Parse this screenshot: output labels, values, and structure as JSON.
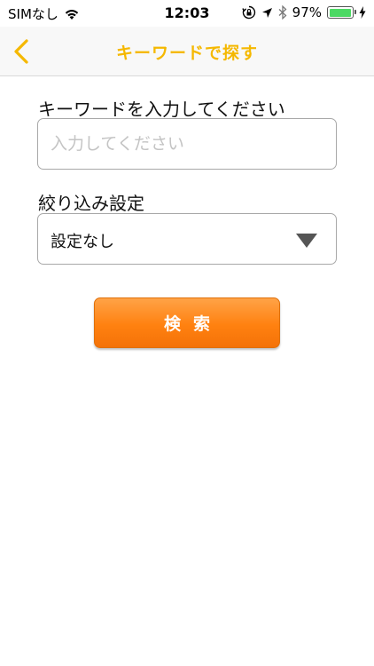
{
  "status_bar": {
    "carrier": "SIMなし",
    "time": "12:03",
    "battery_percent": "97%",
    "battery_level": 0.97,
    "battery_color": "#4cd964"
  },
  "nav": {
    "title": "キーワードで探す",
    "back_icon": "chevron-left-icon",
    "accent_color": "#f5b800"
  },
  "form": {
    "keyword_label": "キーワードを入力してください",
    "keyword_placeholder": "入力してください",
    "keyword_value": "",
    "filter_label": "絞り込み設定",
    "filter_selected": "設定なし",
    "search_button_label": "検索",
    "button_color": "#ff8110"
  }
}
